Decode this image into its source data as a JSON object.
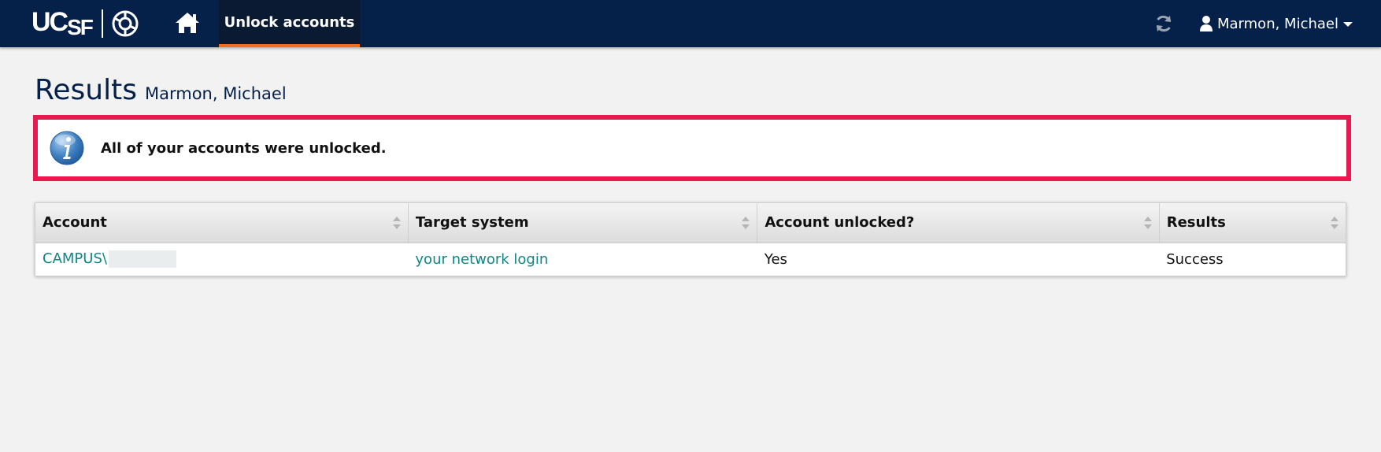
{
  "header": {
    "logo_text_uc": "UC",
    "logo_text_sf": "SF",
    "active_tab": "Unlock accounts",
    "user_name": "Marmon, Michael"
  },
  "page": {
    "title": "Results",
    "subtitle": "Marmon, Michael"
  },
  "alert": {
    "message": "All of your accounts were unlocked."
  },
  "table": {
    "columns": [
      "Account",
      "Target system",
      "Account unlocked?",
      "Results"
    ],
    "rows": [
      {
        "account": "CAMPUS\\",
        "target_system": "your network login",
        "unlocked": "Yes",
        "result": "Success"
      }
    ]
  },
  "colors": {
    "navbar": "#052049",
    "tab_accent": "#f26d21",
    "alert_border": "#e8194f",
    "link": "#0f8585"
  }
}
